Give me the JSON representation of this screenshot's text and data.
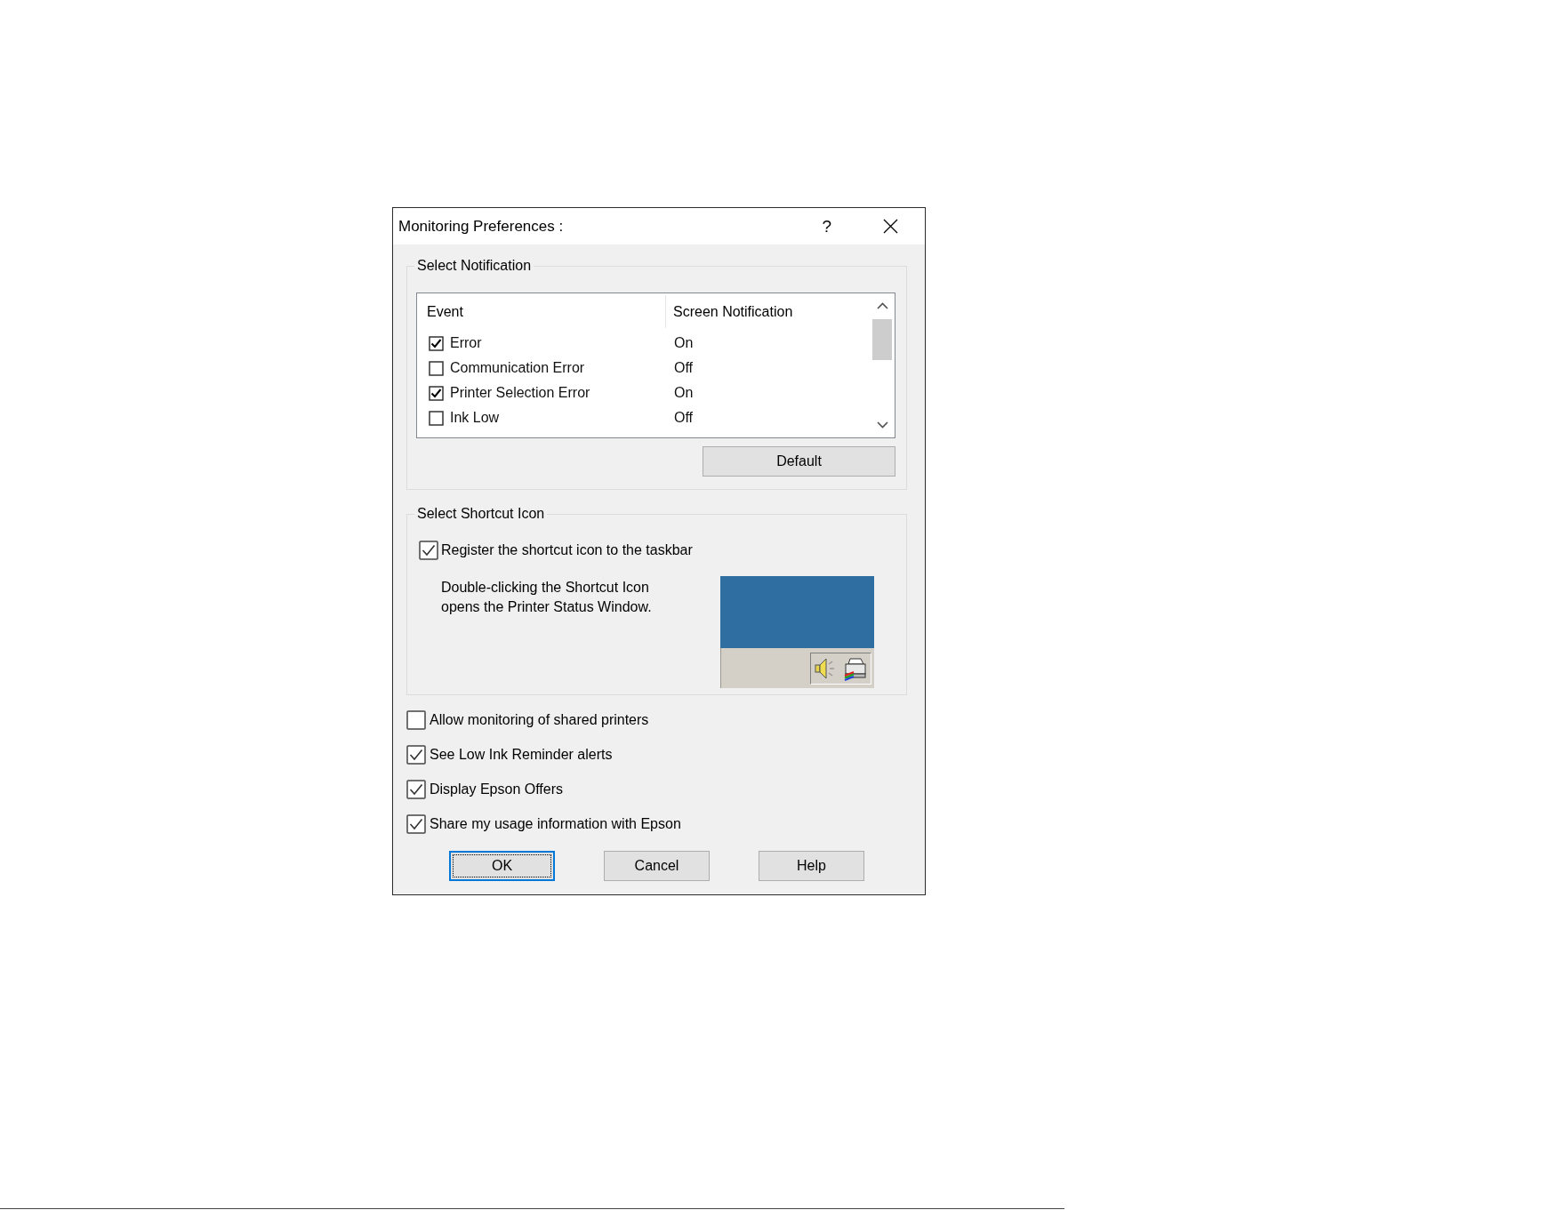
{
  "window": {
    "title": "Monitoring Preferences :",
    "help_label": "?"
  },
  "notification": {
    "title": "Select Notification",
    "columns": [
      "Event",
      "Screen Notification"
    ],
    "rows": [
      {
        "event": "Error",
        "checked": true,
        "notification": "On"
      },
      {
        "event": "Communication Error",
        "checked": false,
        "notification": "Off"
      },
      {
        "event": "Printer Selection Error",
        "checked": true,
        "notification": "On"
      },
      {
        "event": "Ink Low",
        "checked": false,
        "notification": "Off"
      }
    ],
    "default_button": "Default"
  },
  "shortcut": {
    "title": "Select Shortcut Icon",
    "register": {
      "label": "Register the shortcut icon to the taskbar",
      "checked": true
    },
    "description": [
      "Double-clicking the Shortcut Icon",
      "opens the Printer Status Window."
    ]
  },
  "options": [
    {
      "label": "Allow monitoring of shared printers",
      "checked": false
    },
    {
      "label": "See Low Ink Reminder alerts",
      "checked": true
    },
    {
      "label": "Display Epson Offers",
      "checked": true
    },
    {
      "label": "Share my usage information with Epson",
      "checked": true
    }
  ],
  "buttons": [
    {
      "label": "OK",
      "focused": true
    },
    {
      "label": "Cancel",
      "focused": false
    },
    {
      "label": "Help",
      "focused": false
    }
  ]
}
